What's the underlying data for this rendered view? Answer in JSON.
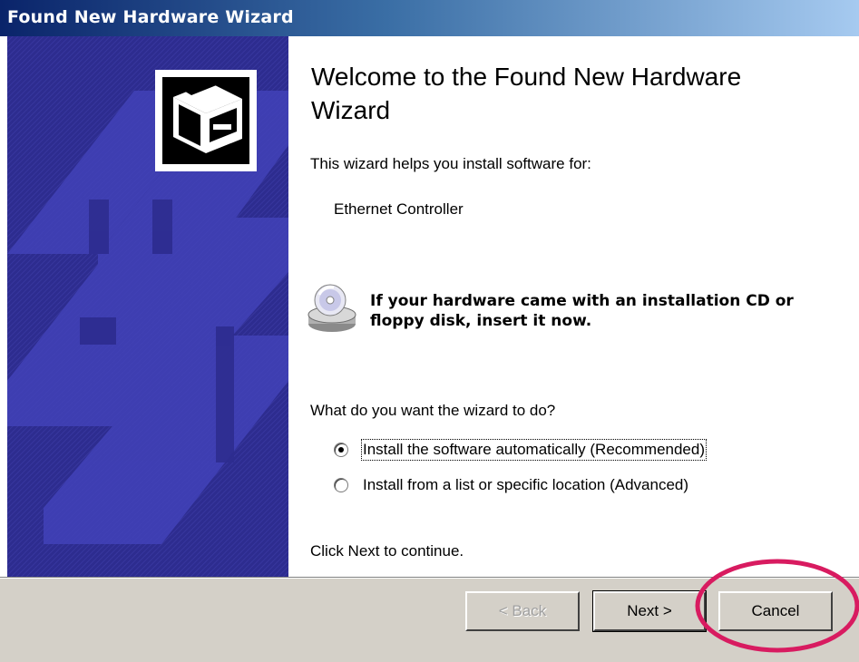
{
  "window": {
    "title": "Found New Hardware Wizard"
  },
  "main": {
    "heading": "Welcome to the Found New Hardware Wizard",
    "intro": "This wizard helps you install software for:",
    "device": "Ethernet Controller",
    "cd_message": "If your hardware came with an installation CD or floppy disk, insert it now.",
    "question": "What do you want the wizard to do?",
    "options": [
      {
        "label": "Install the software automatically (Recommended)",
        "selected": true
      },
      {
        "label": "Install from a list or specific location (Advanced)",
        "selected": false
      }
    ],
    "footer_text": "Click Next to continue."
  },
  "buttons": {
    "back": "< Back",
    "next": "Next >",
    "cancel": "Cancel"
  },
  "icons": {
    "wizard_badge": "hardware-drive-icon",
    "cd": "cd-drive-icon"
  },
  "colors": {
    "titlebar_start": "#0a246a",
    "titlebar_end": "#a6caf0",
    "side_panel": "#2e2f8e",
    "button_face": "#d4d0c8",
    "highlight_ring": "#d81b60"
  }
}
